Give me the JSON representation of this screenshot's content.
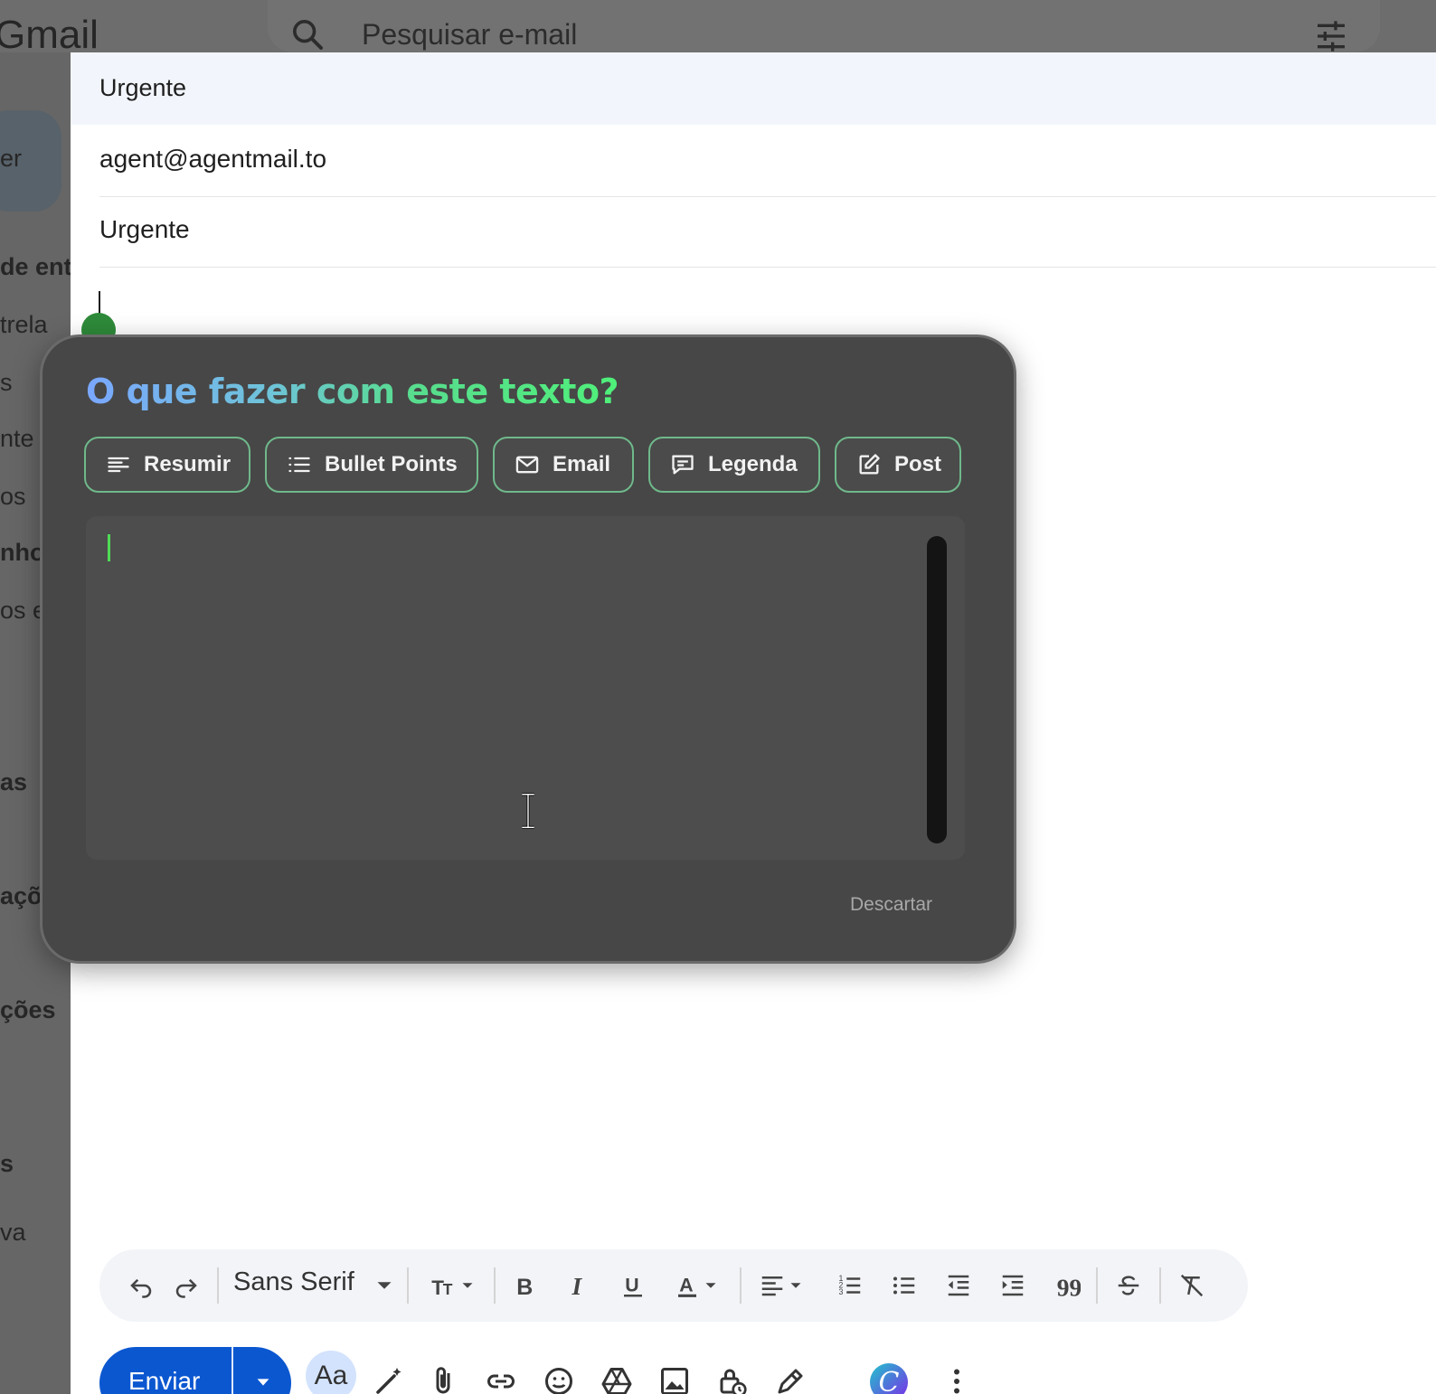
{
  "app": {
    "logo_text": "Gmail"
  },
  "search": {
    "placeholder": "Pesquisar e-mail"
  },
  "sidebar": {
    "partial_labels": [
      "er",
      "de ent",
      "trela",
      "s",
      "nte",
      "os",
      "nho",
      "os e",
      "as",
      "açõ",
      "ções",
      "s",
      "va"
    ]
  },
  "compose": {
    "window_title": "Urgente",
    "to": "agent@agentmail.to",
    "subject": "Urgente"
  },
  "popup": {
    "title": "O que fazer com este texto?",
    "options": [
      {
        "label": "Resumir",
        "icon": "align-left-icon"
      },
      {
        "label": "Bullet Points",
        "icon": "list-icon"
      },
      {
        "label": "Email",
        "icon": "mail-icon"
      },
      {
        "label": "Legenda",
        "icon": "chat-bubble-icon"
      },
      {
        "label": "Post",
        "icon": "edit-square-icon"
      }
    ],
    "text_value": "",
    "discard_label": "Descartar",
    "accent_gradient": [
      "#7aa7ff",
      "#4ff07a"
    ]
  },
  "format_toolbar": {
    "font": "Sans Serif"
  },
  "bottom_bar": {
    "send_label": "Enviar",
    "formatting_label": "Aa"
  },
  "colors": {
    "send": "#0b57d0",
    "popup_bg": "#474747",
    "button_border": "#6fb98b"
  }
}
